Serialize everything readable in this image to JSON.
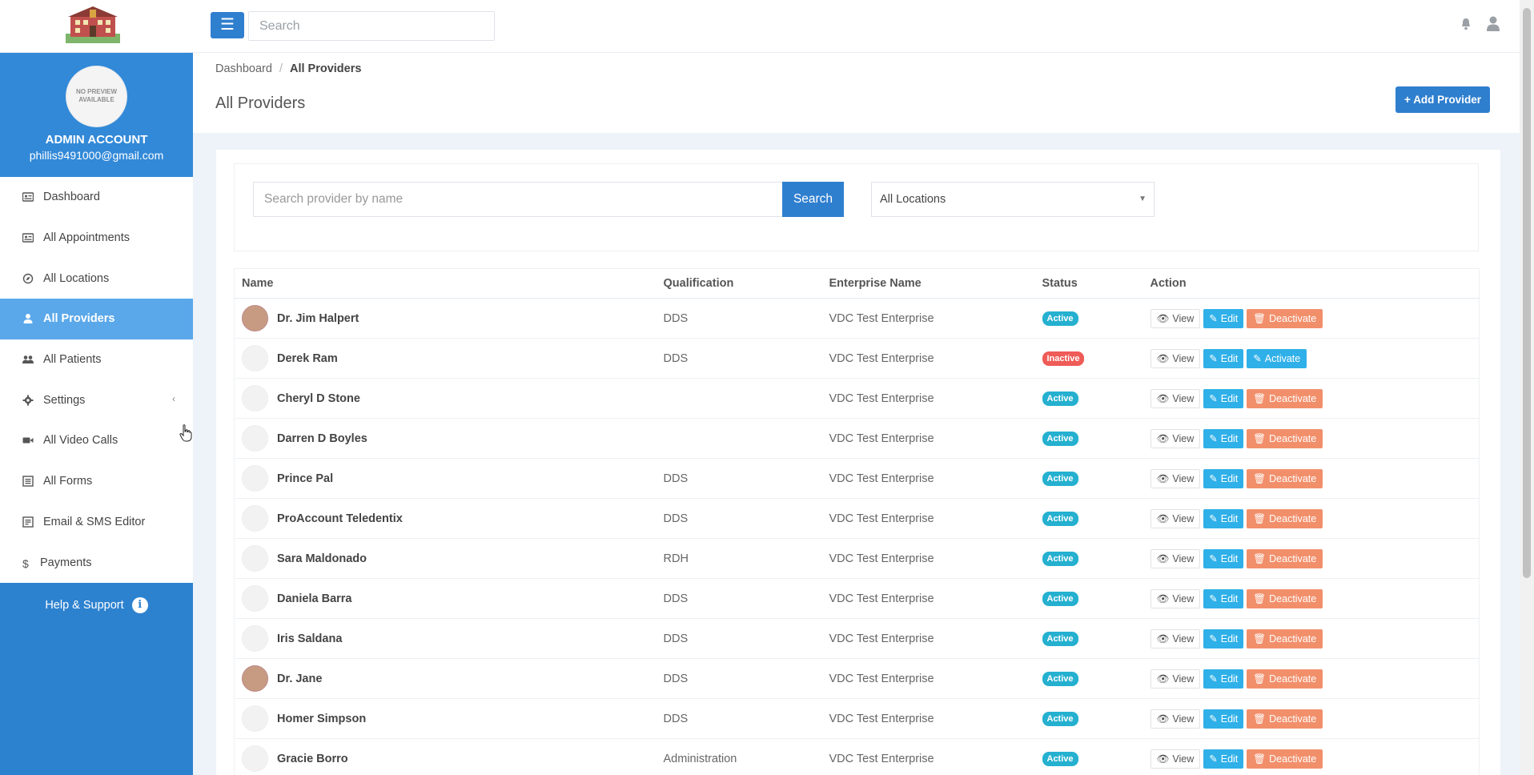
{
  "topbar": {
    "search_placeholder": "Search"
  },
  "profile": {
    "avatar_text": "NO PREVIEW AVAILABLE",
    "name": "ADMIN ACCOUNT",
    "email": "phillis9491000@gmail.com"
  },
  "nav": {
    "items": [
      {
        "label": "Dashboard",
        "icon": "id-card-icon"
      },
      {
        "label": "All Appointments",
        "icon": "id-card-icon"
      },
      {
        "label": "All Locations",
        "icon": "compass-icon"
      },
      {
        "label": "All Providers",
        "icon": "user-icon",
        "active": true
      },
      {
        "label": "All Patients",
        "icon": "users-icon"
      },
      {
        "label": "Settings",
        "icon": "gear-icon"
      },
      {
        "label": "All Video Calls",
        "icon": "video-icon"
      },
      {
        "label": "All Forms",
        "icon": "list-icon"
      },
      {
        "label": "Email & SMS Editor",
        "icon": "edit-icon"
      },
      {
        "label": "Payments",
        "icon": "dollar-icon"
      }
    ],
    "help": "Help & Support"
  },
  "breadcrumb": {
    "home": "Dashboard",
    "current": "All Providers"
  },
  "page": {
    "title": "All Providers",
    "add_button": "Add Provider"
  },
  "filters": {
    "search_placeholder": "Search provider by name",
    "search_button": "Search",
    "location_selected": "All Locations"
  },
  "table": {
    "headers": {
      "name": "Name",
      "qualification": "Qualification",
      "enterprise": "Enterprise Name",
      "status": "Status",
      "action": "Action"
    },
    "labels": {
      "view": "View",
      "edit": "Edit",
      "deactivate": "Deactivate",
      "activate": "Activate"
    },
    "rows": [
      {
        "name": "Dr. Jim Halpert",
        "qualification": "DDS",
        "enterprise": "VDC Test Enterprise",
        "status": "Active",
        "photo": true
      },
      {
        "name": "Derek Ram",
        "qualification": "DDS",
        "enterprise": "VDC Test Enterprise",
        "status": "Inactive",
        "photo": false
      },
      {
        "name": "Cheryl D Stone",
        "qualification": "",
        "enterprise": "VDC Test Enterprise",
        "status": "Active",
        "photo": false
      },
      {
        "name": "Darren D Boyles",
        "qualification": "",
        "enterprise": "VDC Test Enterprise",
        "status": "Active",
        "photo": false
      },
      {
        "name": "Prince Pal",
        "qualification": "DDS",
        "enterprise": "VDC Test Enterprise",
        "status": "Active",
        "photo": false
      },
      {
        "name": "ProAccount Teledentix",
        "qualification": "DDS",
        "enterprise": "VDC Test Enterprise",
        "status": "Active",
        "photo": false
      },
      {
        "name": "Sara Maldonado",
        "qualification": "RDH",
        "enterprise": "VDC Test Enterprise",
        "status": "Active",
        "photo": false
      },
      {
        "name": "Daniela Barra",
        "qualification": "DDS",
        "enterprise": "VDC Test Enterprise",
        "status": "Active",
        "photo": false
      },
      {
        "name": "Iris Saldana",
        "qualification": "DDS",
        "enterprise": "VDC Test Enterprise",
        "status": "Active",
        "photo": false
      },
      {
        "name": "Dr. Jane",
        "qualification": "DDS",
        "enterprise": "VDC Test Enterprise",
        "status": "Active",
        "photo": true
      },
      {
        "name": "Homer Simpson",
        "qualification": "DDS",
        "enterprise": "VDC Test Enterprise",
        "status": "Active",
        "photo": false
      },
      {
        "name": "Gracie Borro",
        "qualification": "Administration",
        "enterprise": "VDC Test Enterprise",
        "status": "Active",
        "photo": false
      }
    ]
  },
  "colors": {
    "primary": "#2f7fcf",
    "sidebar": "#2d82d0",
    "active_nav": "#5aa8ea",
    "active_badge": "#25b0d0",
    "inactive_badge": "#ef5b57",
    "edit": "#2fb0e8",
    "deactivate": "#f28f6b"
  }
}
